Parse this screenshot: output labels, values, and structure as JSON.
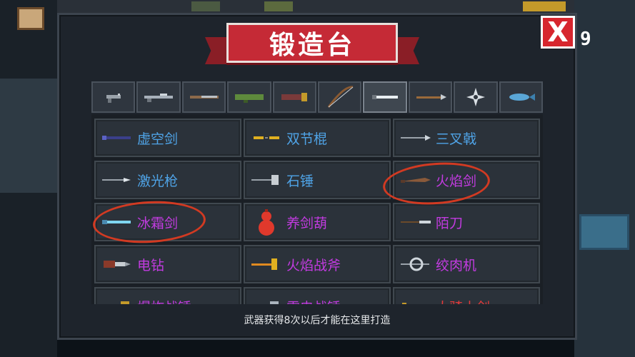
{
  "title": "锻造台",
  "close_label": "X",
  "close_count": "9",
  "tabs": [
    {
      "icon": "pistol-icon"
    },
    {
      "icon": "rifle-icon"
    },
    {
      "icon": "shotgun-icon"
    },
    {
      "icon": "launcher-icon"
    },
    {
      "icon": "heavy-gun-icon"
    },
    {
      "icon": "bow-icon"
    },
    {
      "icon": "sword-icon",
      "active": true
    },
    {
      "icon": "spear-icon"
    },
    {
      "icon": "shuriken-icon"
    },
    {
      "icon": "fish-icon"
    }
  ],
  "weapons": [
    {
      "name": "虚空剑",
      "color": "#4fa3e6",
      "icon": "void-sword-icon"
    },
    {
      "name": "双节棍",
      "color": "#4fa3e6",
      "icon": "nunchaku-icon"
    },
    {
      "name": "三叉戟",
      "color": "#4fa3e6",
      "icon": "trident-icon"
    },
    {
      "name": "激光枪",
      "color": "#4fa3e6",
      "icon": "laser-spear-icon"
    },
    {
      "name": "石锤",
      "color": "#4fa3e6",
      "icon": "stone-hammer-icon"
    },
    {
      "name": "火焰剑",
      "color": "#c23be0",
      "icon": "flame-sword-icon"
    },
    {
      "name": "冰霜剑",
      "color": "#c23be0",
      "icon": "frost-sword-icon"
    },
    {
      "name": "养剑葫",
      "color": "#c23be0",
      "icon": "gourd-icon"
    },
    {
      "name": "陌刀",
      "color": "#c23be0",
      "icon": "mo-blade-icon"
    },
    {
      "name": "电钻",
      "color": "#c23be0",
      "icon": "drill-icon"
    },
    {
      "name": "火焰战斧",
      "color": "#c23be0",
      "icon": "flame-axe-icon"
    },
    {
      "name": "绞肉机",
      "color": "#c23be0",
      "icon": "meat-grinder-icon"
    },
    {
      "name": "爆炸战锤",
      "color": "#c23be0",
      "icon": "explosive-hammer-icon"
    },
    {
      "name": "雷电战锤",
      "color": "#c23be0",
      "icon": "thunder-hammer-icon"
    },
    {
      "name": "大骑士剑",
      "color": "#e53a3a",
      "icon": "knight-sword-icon"
    }
  ],
  "footer_note": "武器获得8次以后才能在这里打造"
}
